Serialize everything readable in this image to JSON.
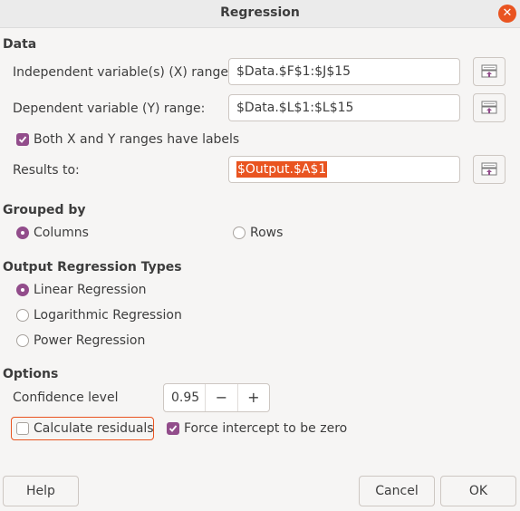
{
  "window": {
    "title": "Regression"
  },
  "data_section": {
    "title": "Data",
    "x_range_label": "Independent variable(s) (X) range:",
    "x_range_value": "$Data.$F$1:$J$15",
    "y_range_label": "Dependent variable (Y) range:",
    "y_range_value": "$Data.$L$1:$L$15",
    "labels_checkbox": "Both X and Y ranges have labels",
    "results_label": "Results to:",
    "results_value": "$Output.$A$1"
  },
  "grouped_by": {
    "title": "Grouped by",
    "columns": "Columns",
    "rows": "Rows"
  },
  "output_types": {
    "title": "Output Regression Types",
    "linear": "Linear Regression",
    "logarithmic": "Logarithmic Regression",
    "power": "Power Regression"
  },
  "options": {
    "title": "Options",
    "confidence_label": "Confidence level",
    "confidence_value": "0.95",
    "residuals": "Calculate residuals",
    "force_intercept": "Force intercept to be zero"
  },
  "buttons": {
    "help": "Help",
    "cancel": "Cancel",
    "ok": "OK"
  },
  "icons": {
    "close": "close-icon",
    "shrink": "shrink-icon",
    "minus": "minus-icon",
    "plus": "plus-icon"
  },
  "colors": {
    "accent": "#e95420",
    "check": "#924d8b"
  }
}
